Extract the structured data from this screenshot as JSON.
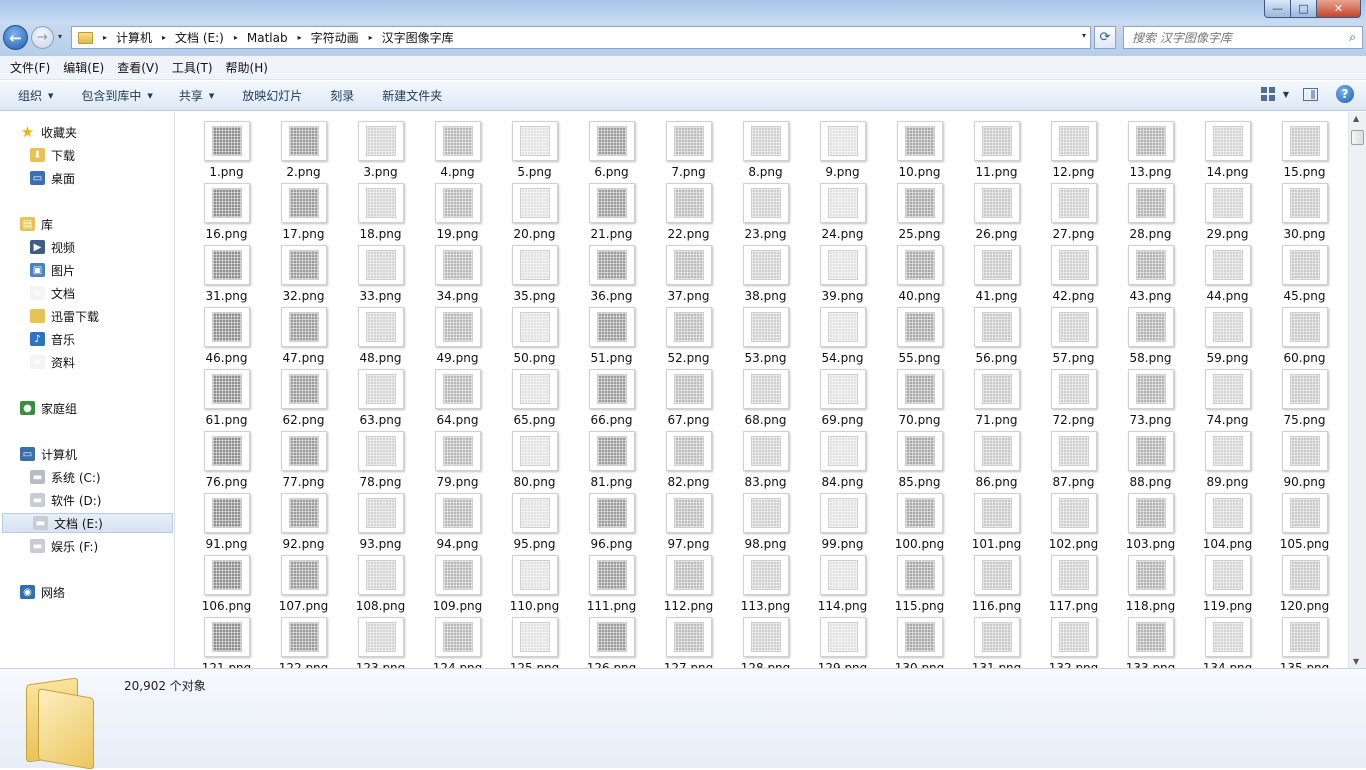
{
  "window": {
    "min": "—",
    "max": "□",
    "close": "✕"
  },
  "nav": {
    "back": "←",
    "forward": "→",
    "recent": "▾",
    "refresh": "⟳"
  },
  "address": {
    "crumbs": [
      "计算机",
      "文档 (E:)",
      "Matlab",
      "字符动画",
      "汉字图像字库"
    ],
    "separator": "▸",
    "dropdown": "▾"
  },
  "search": {
    "placeholder": "搜索 汉字图像字库",
    "icon": "search-icon"
  },
  "menu": [
    "文件(F)",
    "编辑(E)",
    "查看(V)",
    "工具(T)",
    "帮助(H)"
  ],
  "toolbar": {
    "organize": "组织",
    "include_library": "包含到库中",
    "share": "共享",
    "slideshow": "放映幻灯片",
    "burn": "刻录",
    "new_folder": "新建文件夹",
    "caret": "▼",
    "help": "?"
  },
  "sidebar": {
    "items": [
      {
        "label": "收藏夹",
        "icon": "star-icon",
        "color": "#f2b400"
      },
      {
        "label": "下载",
        "icon": "downloads-folder-icon",
        "color": "#e8c255"
      },
      {
        "label": "桌面",
        "icon": "desktop-icon",
        "color": "#3a6fb3"
      },
      {
        "label": "库",
        "icon": "library-icon",
        "color": "#e8c255"
      },
      {
        "label": "视频",
        "icon": "video-icon",
        "color": "#3d5d86"
      },
      {
        "label": "图片",
        "icon": "pictures-icon",
        "color": "#4a83c5"
      },
      {
        "label": "文档",
        "icon": "document-icon",
        "color": "#f4f4f4"
      },
      {
        "label": "迅雷下载",
        "icon": "folder-icon",
        "color": "#e8c255"
      },
      {
        "label": "音乐",
        "icon": "music-icon",
        "color": "#2f72c4"
      },
      {
        "label": "资料",
        "icon": "document-icon",
        "color": "#f4f4f4"
      },
      {
        "label": "家庭组",
        "icon": "homegroup-icon",
        "color": "#3a8f3a"
      },
      {
        "label": "计算机",
        "icon": "computer-icon",
        "color": "#3c6ea8"
      },
      {
        "label": "系统 (C:)",
        "icon": "system-drive-icon",
        "color": "#b7bcc4"
      },
      {
        "label": "软件 (D:)",
        "icon": "drive-icon",
        "color": "#c9cdd3"
      },
      {
        "label": "文档 (E:)",
        "icon": "drive-icon",
        "color": "#c9cdd3"
      },
      {
        "label": "娱乐 (F:)",
        "icon": "drive-icon",
        "color": "#c9cdd3"
      },
      {
        "label": "网络",
        "icon": "network-icon",
        "color": "#2e6fb8"
      }
    ],
    "selected": "文档 (E:)"
  },
  "files": {
    "extension": ".png",
    "first": 1,
    "visible_last": 135,
    "thumbnail_shades": [
      "#c9c9c9",
      "#bdbdbd",
      "#d4d4d4",
      "#a9a9a9",
      "#9c9c9c",
      "#b3b3b3",
      "#e2e2e2",
      "#8f8f8f",
      "#cfcfcf",
      "#b8b8b8"
    ]
  },
  "status": {
    "count": "20,902 个对象",
    "icon": "folder-icon"
  }
}
